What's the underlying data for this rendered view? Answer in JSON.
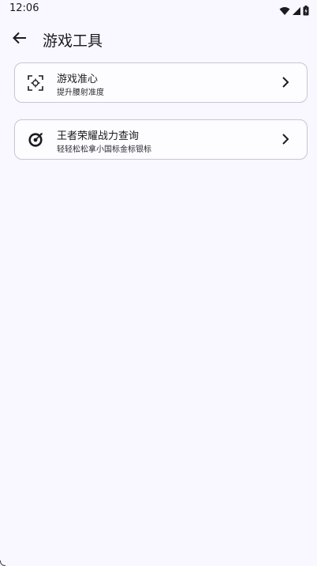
{
  "status_bar": {
    "time": "12:06"
  },
  "app_bar": {
    "title": "游戏工具"
  },
  "items": [
    {
      "title": "游戏准心",
      "subtitle": "提升腰射准度",
      "icon": "crosshair-focus-icon"
    },
    {
      "title": "王者荣耀战力查询",
      "subtitle": "轻轻松松拿小国标金标银标",
      "icon": "target-disc-icon"
    }
  ],
  "colors": {
    "background": "#f9f7ff",
    "card_border": "#c9c6d2",
    "text": "#1c1b1f"
  }
}
